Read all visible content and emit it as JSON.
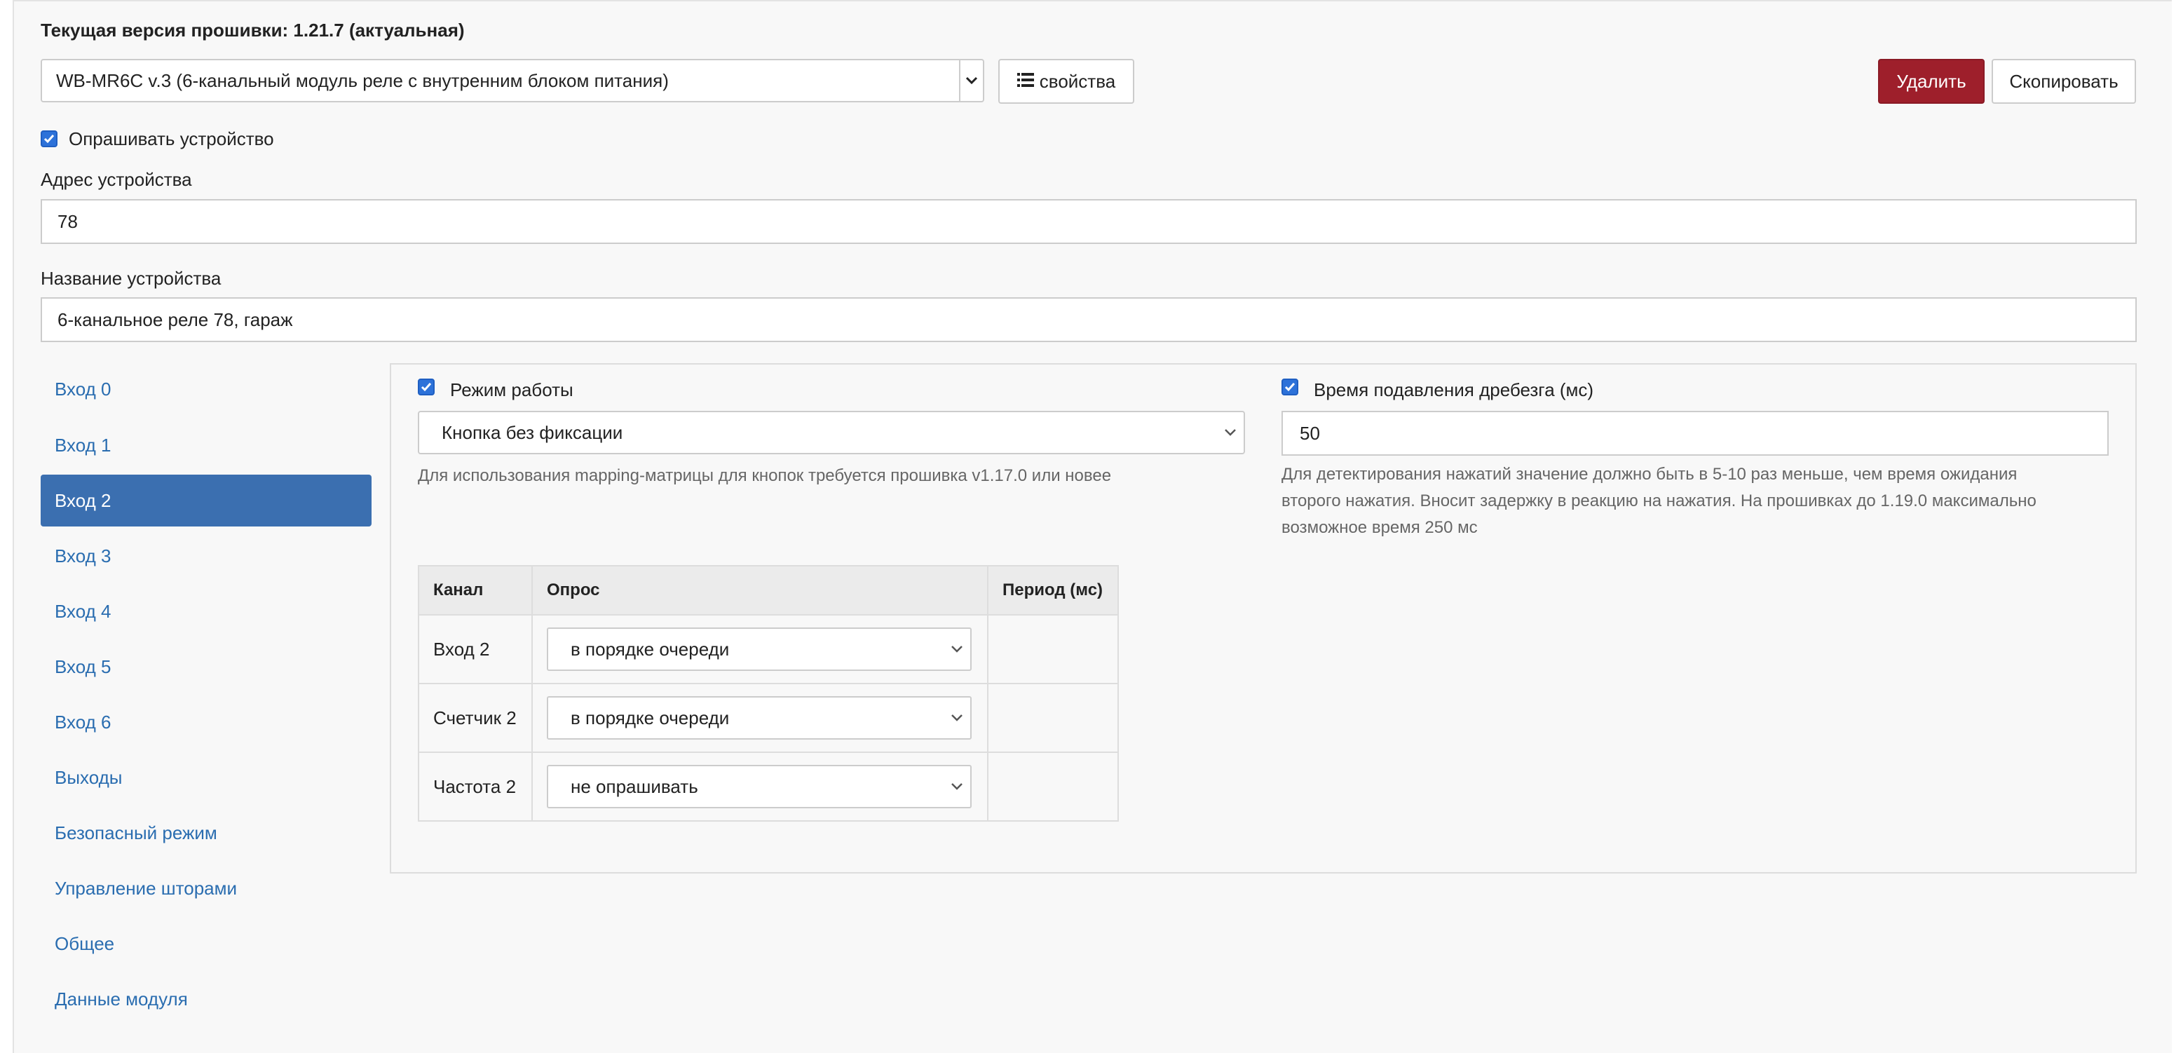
{
  "firmware": {
    "title": "Текущая версия прошивки: 1.21.7 (актуальная)"
  },
  "device": {
    "selected": "WB-MR6C v.3 (6-канальный модуль реле с внутренним блоком питания)",
    "props_label": "свойства",
    "delete_label": "Удалить",
    "copy_label": "Скопировать"
  },
  "poll_device": {
    "label": "Опрашивать устройство",
    "checked": true
  },
  "address": {
    "label": "Адрес устройства",
    "value": "78"
  },
  "name": {
    "label": "Название устройства",
    "value": "6-канальное реле 78, гараж"
  },
  "nav": {
    "items": [
      {
        "label": "Вход 0"
      },
      {
        "label": "Вход 1"
      },
      {
        "label": "Вход 2",
        "active": true
      },
      {
        "label": "Вход 3"
      },
      {
        "label": "Вход 4"
      },
      {
        "label": "Вход 5"
      },
      {
        "label": "Вход 6"
      },
      {
        "label": "Выходы"
      },
      {
        "label": "Безопасный режим"
      },
      {
        "label": "Управление шторами"
      },
      {
        "label": "Общее"
      },
      {
        "label": "Данные модуля"
      }
    ]
  },
  "mode": {
    "label": "Режим работы",
    "checked": true,
    "value": "Кнопка без фиксации",
    "help": "Для использования mapping-матрицы для кнопок требуется прошивка v1.17.0 или новее"
  },
  "debounce": {
    "label": "Время подавления дребезга (мс)",
    "checked": true,
    "value": "50",
    "help_lines": [
      "Для детектирования нажатий значение должно быть в 5-10 раз меньше, чем время ожидания",
      "второго нажатия. Вносит задержку в реакцию на нажатия. На прошивках до 1.19.0 максимально",
      "возможное время 250 мс"
    ]
  },
  "table": {
    "headers": {
      "channel": "Канал",
      "poll": "Опрос",
      "period": "Период (мс)"
    },
    "rows": [
      {
        "channel": "Вход 2",
        "poll": "в порядке очереди",
        "period": ""
      },
      {
        "channel": "Счетчик 2",
        "poll": "в порядке очереди",
        "period": ""
      },
      {
        "channel": "Частота 2",
        "poll": "не опрашивать",
        "period": ""
      }
    ]
  },
  "colors": {
    "primary": "#3b6fb0",
    "danger": "#9e1f2b",
    "link": "#2a6db0",
    "checkbox": "#2d72d9"
  },
  "icons": {
    "props": "list-icon",
    "select": "chevron-down-icon",
    "checkbox": "check-icon"
  }
}
